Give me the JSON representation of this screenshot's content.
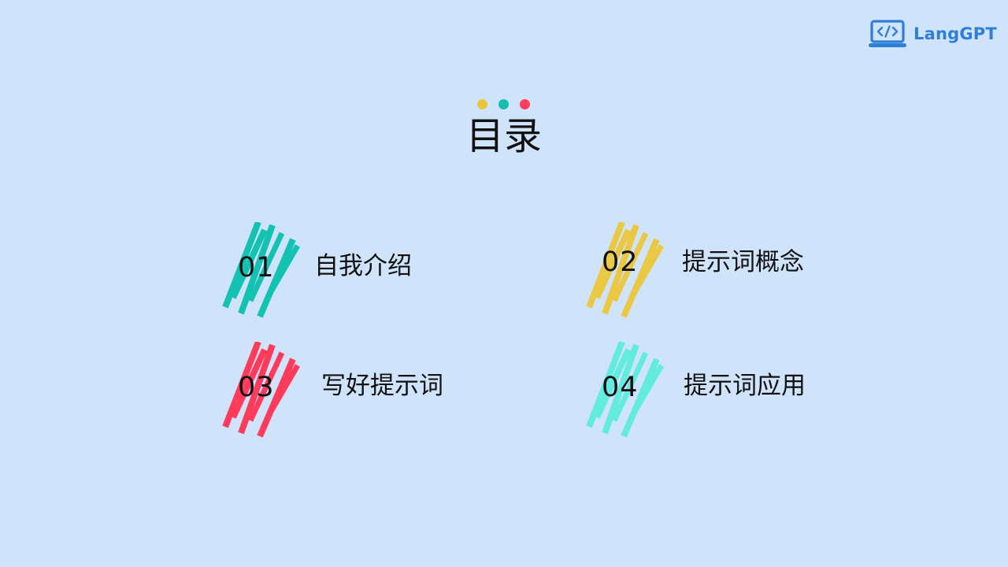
{
  "logo": {
    "text": "LangGPT",
    "color": "#2f7fd8"
  },
  "title": "目录",
  "dots": [
    "#e8c43c",
    "#15bfb0",
    "#ff3d5e"
  ],
  "items": [
    {
      "num": "01",
      "label": "自我介绍",
      "color": "#13c2b2",
      "icon": "teal-stripe-icon"
    },
    {
      "num": "02",
      "label": "提示词概念",
      "color": "#ebc844",
      "icon": "yellow-stripe-icon"
    },
    {
      "num": "03",
      "label": "写好提示词",
      "color": "#ff3b5c",
      "icon": "red-stripe-icon"
    },
    {
      "num": "04",
      "label": "提示词应用",
      "color": "#62ece0",
      "icon": "cyan-stripe-icon"
    }
  ]
}
